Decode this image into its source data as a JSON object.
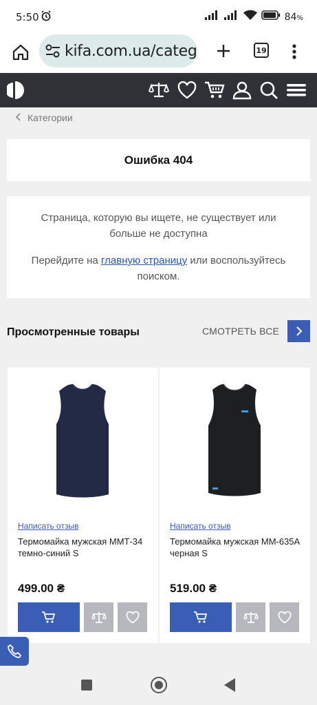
{
  "status_bar": {
    "time": "5:50",
    "battery": "84",
    "battery_unit": "%"
  },
  "browser": {
    "url": "kifa.com.ua/categ",
    "tab_count": "19"
  },
  "breadcrumb": {
    "label": "Категории"
  },
  "error": {
    "title": "Ошибка 404",
    "message": "Страница, которую вы ищете, не существует или больше не доступна",
    "hint_prefix": "Перейдите на ",
    "hint_link": "главную страницу",
    "hint_suffix": " или воспользуйтесь поиском."
  },
  "viewed": {
    "title": "Просмотренные товары",
    "see_all": "СМОТРЕТЬ ВСЕ",
    "products": [
      {
        "review": "Написать отзыв",
        "name": "Термомайка мужская ММТ-34 темно-синий S",
        "price": "499.00 ₴",
        "image": "navy-tank-top",
        "color": "#232a45"
      },
      {
        "review": "Написать отзыв",
        "name": "Термомайка мужская ММ-635А черная S",
        "price": "519.00 ₴",
        "image": "black-tank-top",
        "color": "#1e1f21"
      }
    ]
  },
  "colors": {
    "accent": "#3a5db5",
    "header_bg": "#2f3136",
    "button_gray": "#b7b8be"
  }
}
